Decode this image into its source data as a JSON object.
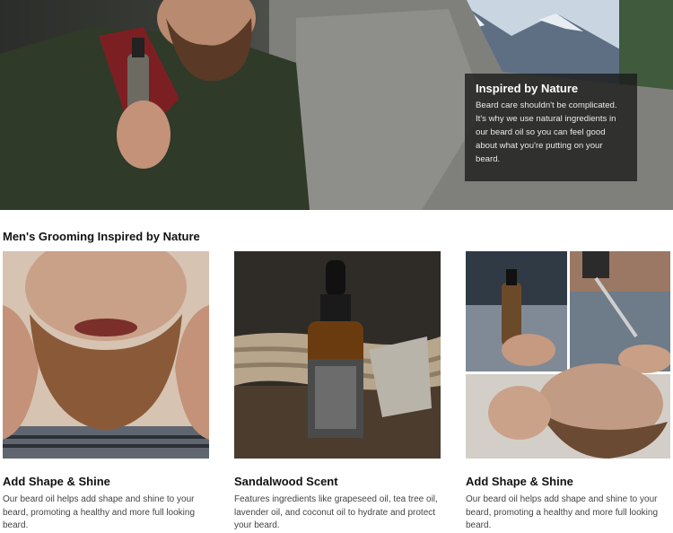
{
  "hero": {
    "heading": "Inspired by Nature",
    "body": "Beard care shouldn't be complicated. It's why we use natural ingredients in our beard oil so you can feel good about what you're putting on your beard."
  },
  "section": {
    "title": "Men's Grooming Inspired by Nature"
  },
  "cards": [
    {
      "title": "Add Shape & Shine",
      "description": "Our beard oil helps add shape and shine to your beard, promoting a healthy and more full looking beard."
    },
    {
      "title": "Sandalwood Scent",
      "description": "Features ingredients like grapeseed oil, tea tree oil, lavender oil, and coconut oil to hydrate and protect your beard."
    },
    {
      "title": "Add Shape & Shine",
      "description": "Our beard oil helps add shape and shine to your beard, promoting a healthy and more full looking beard."
    }
  ]
}
